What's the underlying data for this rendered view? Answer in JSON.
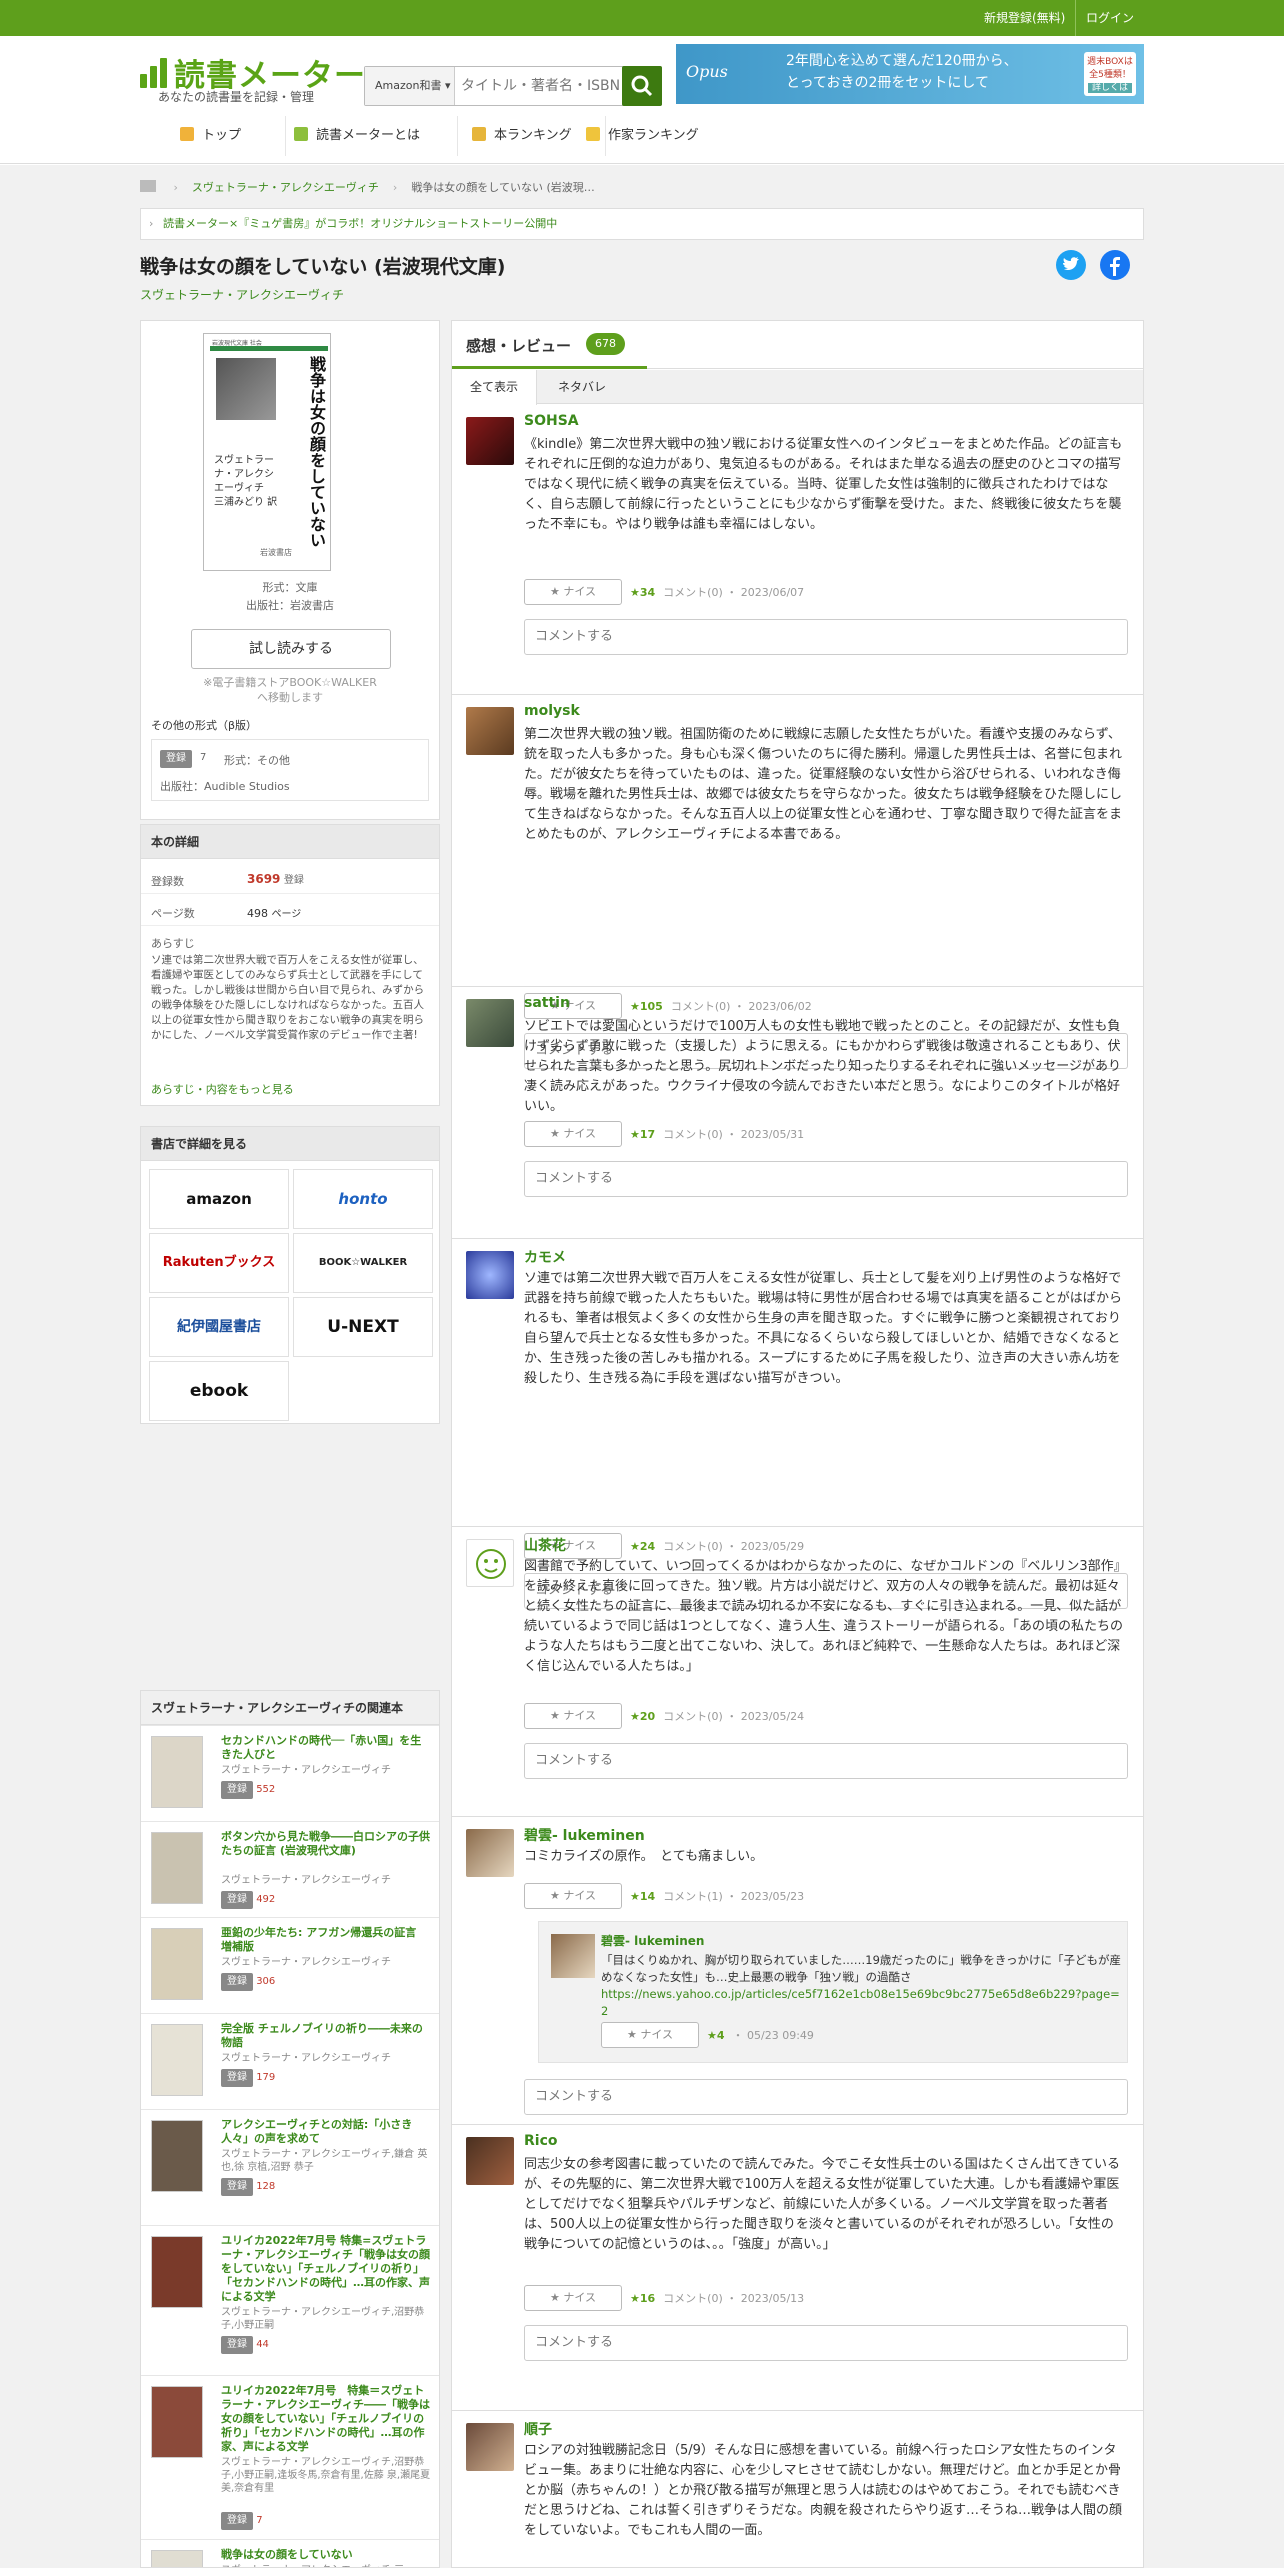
{
  "topbar": {
    "register": "新規登録(無料)",
    "login": "ログイン"
  },
  "logo": {
    "title": "読書メーター",
    "subtitle": "あなたの読書量を記録・管理"
  },
  "search": {
    "category": "Amazon和書 ▾",
    "placeholder": "タイトル・著者名・ISBN"
  },
  "banner": {
    "text1": "2年間心を込めて選んだ120冊から、",
    "text2": "とっておきの2冊をセットにして",
    "badge1": "週末BOXは",
    "badge2": "全5種類！",
    "badge3": "詳しくは",
    "logo_text": "Opus"
  },
  "nav": [
    "トップ",
    "読書メーターとは",
    "本ランキング",
    "作家ランキング"
  ],
  "breadcrumb": {
    "author": "スヴェトラーナ・アレクシエーヴィチ",
    "book": "戦争は女の顔をしていない (岩波現…"
  },
  "notice": "読書メーター×『ミュゲ書房』がコラボ！オリジナルショートストーリー公開中",
  "book": {
    "title": "戦争は女の顔をしていない (岩波現代文庫)",
    "author": "スヴェトラーナ・アレクシエーヴィチ",
    "cover_series": "岩波現代文庫 社会",
    "cover_title": "戦争は女の顔をしていない",
    "cover_author": "スヴェトラーナ・アレクシエーヴィチ",
    "cover_translator": "三浦みどり 訳",
    "cover_publisher": "岩波書店",
    "format": "形式：文庫",
    "publisher": "出版社：岩波書店",
    "trial_button": "試し読みする",
    "trial_note": "※電子書籍ストアBOOK☆WALKER",
    "trial_note2": "へ移動します",
    "other_formats": "その他の形式（β版）",
    "other_badge": "登録",
    "other_count": "7",
    "other_format": "形式：その他",
    "other_publisher": "出版社：Audible Studios"
  },
  "details": {
    "header": "本の詳細",
    "reg_label": "登録数",
    "reg_value": "3699",
    "reg_unit": "登録",
    "pages_label": "ページ数",
    "pages_value": "498",
    "pages_unit": "ページ",
    "synopsis_label": "あらすじ",
    "synopsis": "ソ連では第二次世界大戦で百万人をこえる女性が従軍し、看護婦や軍医としてのみならず兵士として武器を手にして戦った。しかし戦後は世間から白い目で見られ、みずからの戦争体験をひた隠しにしなければならなかった。五百人以上の従軍女性から聞き取りをおこない戦争の真実を明らかにした、ノーベル文学賞受賞作家のデビュー作で主著!",
    "more": "あらすじ・内容をもっと見る"
  },
  "stores": {
    "header": "書店で詳細を見る",
    "items": [
      "amazon",
      "honto",
      "Rakutenブックス",
      "BOOK☆WALKER",
      "紀伊國屋書店",
      "U-NEXT",
      "ebook"
    ]
  },
  "related": {
    "header": "スヴェトラーナ・アレクシエーヴィチの関連本",
    "reg_badge": "登録",
    "items": [
      {
        "title": "セカンドハンドの時代──「赤い国」を生きた人びと",
        "author": "スヴェトラーナ・アレクシエーヴィチ",
        "count": "552"
      },
      {
        "title": "ボタン穴から見た戦争――白ロシアの子供たちの証言 (岩波現代文庫)",
        "author": "スヴェトラーナ・アレクシエーヴィチ",
        "count": "492"
      },
      {
        "title": "亜鉛の少年たち: アフガン帰還兵の証言 増補版",
        "author": "スヴェトラーナ・アレクシエーヴィチ",
        "count": "306"
      },
      {
        "title": "完全版 チェルノブイリの祈り――未来の物語",
        "author": "スヴェトラーナ・アレクシエーヴィチ",
        "count": "179"
      },
      {
        "title": "アレクシエーヴィチとの対話:「小さき人々」の声を求めて",
        "author": "スヴェトラーナ・アレクシエーヴィチ,鎌倉 英也,徐 京植,沼野 恭子",
        "count": "128"
      },
      {
        "title": "ユリイカ2022年7月号 特集=スヴェトラーナ・アレクシエーヴィチ「戦争は女の顔をしていない」「チェルノブイリの祈り」「セカンドハンドの時代」…耳の作家、声による文学",
        "author": "スヴェトラーナ・アレクシエーヴィチ,沼野恭子,小野正嗣",
        "count": "44"
      },
      {
        "title": "ユリイカ2022年7月号　特集＝スヴェトラーナ・アレクシエーヴィチ――「戦争は女の顔をしていない」「チェルノブイリの祈り」「セカンドハンドの時代」…耳の作家、声による文学",
        "author": "スヴェトラーナ・アレクシエーヴィチ,沼野恭子,小野正嗣,逢坂冬馬,奈倉有里,佐藤 泉,瀬尾夏美,奈倉有里",
        "count": "7"
      },
      {
        "title": "戦争は女の顔をしていない",
        "author": "スヴェトラーナ・アレクシエーヴィチ,三",
        "count": ""
      }
    ]
  },
  "reviews": {
    "header": "感想・レビュー",
    "count": "678",
    "tab_all": "全て表示",
    "tab_spoiler": "ネタバレ",
    "nice_label": "★ ナイス",
    "comment_placeholder": "コメントする",
    "items": [
      {
        "user": "SOHSA",
        "text": "《kindle》第二次世界大戦中の独ソ戦における従軍女性へのインタビューをまとめた作品。どの証言もそれぞれに圧倒的な迫力があり、鬼気迫るものがある。それはまた単なる過去の歴史のひとコマの描写ではなく現代に続く戦争の真実を伝えている。当時、従軍した女性は強制的に徴兵されたわけではなく、自ら志願して前線に行ったということにも少なからず衝撃を受けた。また、終戦後に彼女たちを襲った不幸にも。やはり戦争は誰も幸福にはしない。",
        "stars": "★34",
        "meta": "コメント(0) ・ 2023/06/07"
      },
      {
        "user": "molysk",
        "text": "第二次世界大戦の独ソ戦。祖国防衛のために戦線に志願した女性たちがいた。看護や支援のみならず、銃を取った人も多かった。身も心も深く傷ついたのちに得た勝利。帰還した男性兵士は、名誉に包まれた。だが彼女たちを待っていたものは、違った。従軍経験のない女性から浴びせられる、いわれなき侮辱。戦場を離れた男性兵士は、故郷では彼女たちを守らなかった。彼女たちは戦争経験をひた隠しにして生きねばならなかった。そんな五百人以上の従軍女性と心を通わせ、丁寧な聞き取りで得た証言をまとめたものが、アレクシエーヴィチによる本書である。",
        "stars": "★105",
        "meta": "コメント(0) ・ 2023/06/02"
      },
      {
        "user": "sattin",
        "text": "ソビエトでは愛国心というだけで100万人もの女性も戦地で戦ったとのこと。その記録だが、女性も負けず劣らず勇敢に戦った（支援した）ように思える。にもかかわらず戦後は敬遠されることもあり、伏せられた言葉も多かったと思う。尻切れトンボだったり知ったりするそれぞれに強いメッセージがあり凄く読み応えがあった。ウクライナ侵攻の今読んでおきたい本だと思う。なによりこのタイトルが格好いい。",
        "stars": "★17",
        "meta": "コメント(0) ・ 2023/05/31"
      },
      {
        "user": "カモメ",
        "text": "ソ連では第二次世界大戦で百万人をこえる女性が従軍し、兵士として髪を刈り上げ男性のような格好で武器を持ち前線で戦った人たちもいた。戦場は特に男性が居合わせる場では真実を語ることがはばかられるも、筆者は根気よく多くの女性から生身の声を聞き取った。すぐに戦争に勝つと楽観視されており自ら望んで兵士となる女性も多かった。不具になるくらいなら殺してほしいとか、結婚できなくなるとか、生き残った後の苦しみも描かれる。スープにするために子馬を殺したり、泣き声の大きい赤ん坊を殺したり、生き残る為に手段を選ばない描写がきつい。",
        "stars": "★24",
        "meta": "コメント(0) ・ 2023/05/29"
      },
      {
        "user": "山茶花",
        "text": "図書館で予約していて、いつ回ってくるかはわからなかったのに、なぜかコルドンの『ベルリン3部作』を読み終えた直後に回ってきた。独ソ戦。片方は小説だけど、双方の人々の戦争を読んだ。最初は延々と続く女性たちの証言に、最後まで読み切れるか不安になるも、すぐに引き込まれる。一見、似た話が続いているようで同じ話は1つとしてなく、違う人生、違うストーリーが語られる。「あの頃の私たちのような人たちはもう二度と出てこないわ、決して。あれほど純粋で、一生懸命な人たちは。あれほど深く信じ込んでいる人たちは。」",
        "stars": "★20",
        "meta": "コメント(0) ・ 2023/05/24"
      },
      {
        "user": "碧雲- lukeminen",
        "text": "コミカライズの原作。　とても痛ましい。",
        "stars": "★14",
        "meta": "コメント(1) ・ 2023/05/23",
        "reply_user": "碧雲- lukeminen",
        "reply_text": "「目はくりぬかれ、胸が切り取られていました……19歳だったのに」戦争をきっかけに「子どもが産めなくなった女性」も…史上最悪の戦争「独ソ戦」の過酷さ",
        "reply_link": "https://news.yahoo.co.jp/articles/ce5f7162e1cb08e15e69bc9bc2775e65d8e6b229?page=2",
        "reply_stars": "★4",
        "reply_meta": "・ 05/23 09:49"
      },
      {
        "user": "Rico",
        "text": "同志少女の参考図書に載っていたので読んでみた。今でこそ女性兵士のいる国はたくさん出てきているが、その先駆的に、第二次世界大戦で100万人を超える女性が従軍していた大連。しかも看護婦や軍医としてだけでなく狙撃兵やパルチザンなど、前線にいた人が多くいる。ノーベル文学賞を取った著者は、500人以上の従軍女性から行った聞き取りを淡々と書いているのがそれぞれが恐ろしい。「女性の戦争についての記憶というのは、。。「強度」が高い。」",
        "stars": "★16",
        "meta": "コメント(0) ・ 2023/05/13"
      },
      {
        "user": "順子",
        "text": "ロシアの対独戦勝記念日（5/9）そんな日に感想を書いている。前線へ行ったロシア女性たちのインタビュー集。あまりに壮絶な内容に、心を少しマヒさせて読むしかない。無理だけど。血とか手足とか骨とか脳（赤ちゃんの！）とか飛び散る描写が無理と思う人は読むのはやめておこう。それでも読むべきだと思うけどね、これは誓く引きずりそうだな。肉親を殺されたらやり返す…そうね…戦争は人間の顔をしていないよ。でもこれも人間の一面。",
        "stars": "",
        "meta": ""
      }
    ]
  }
}
